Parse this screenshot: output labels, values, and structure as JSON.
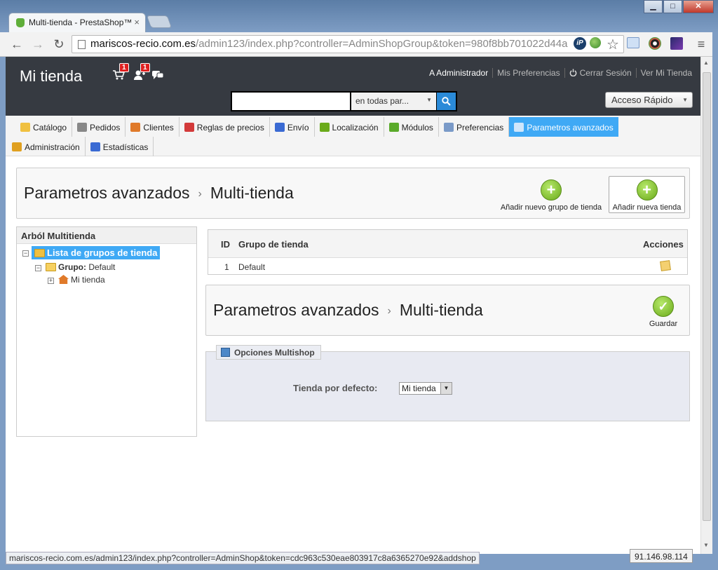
{
  "browser": {
    "tab_title": "Multi-tienda - PrestaShop™",
    "tab_close": "×",
    "url_host": "mariscos-recio.com.es",
    "url_path": "/admin123/index.php?controller=AdminShopGroup&token=980f8bb701022d44a",
    "ip_ext": "iP",
    "status_url": "mariscos-recio.com.es/admin123/index.php?controller=AdminShop&token=cdc963c530eae803917c8a6365270e92&addshop",
    "status_ip": "91.146.98.114",
    "win_minimize": "▁",
    "win_maximize": "□",
    "win_close": "✕",
    "back": "←",
    "forward": "→",
    "reload": "↻",
    "star": "☆",
    "menu_glyph": "≡"
  },
  "header": {
    "shop_name": "Mi tienda",
    "cart_badge": "1",
    "customers_badge": "1",
    "user": "A Administrador",
    "preferences": "Mis Preferencias",
    "logout": "Cerrar Sesión",
    "view_shop": "Ver Mi Tienda",
    "search_scope": "en todas par...",
    "quick_access": "Acceso Rápido"
  },
  "menu": {
    "row1": [
      {
        "label": "Catálogo",
        "icon": "folder-icon",
        "color": "#f0c040"
      },
      {
        "label": "Pedidos",
        "icon": "cart-icon",
        "color": "#888888"
      },
      {
        "label": "Clientes",
        "icon": "user-icon",
        "color": "#e07a2a"
      },
      {
        "label": "Reglas de precios",
        "icon": "price-rule-icon",
        "color": "#d33a3a"
      },
      {
        "label": "Envío",
        "icon": "truck-icon",
        "color": "#3a6ad3"
      },
      {
        "label": "Localización",
        "icon": "globe-icon",
        "color": "#6aaa1a"
      },
      {
        "label": "Módulos",
        "icon": "puzzle-icon",
        "color": "#5aaa2a"
      },
      {
        "label": "Preferencias",
        "icon": "preferences-icon",
        "color": "#7a9ac8"
      },
      {
        "label": "Parametros avanzados",
        "icon": "wrench-icon",
        "color": "#cfe6fb"
      }
    ],
    "row2": [
      {
        "label": "Administración",
        "icon": "key-icon",
        "color": "#e0a020"
      },
      {
        "label": "Estadísticas",
        "icon": "bar-chart-icon",
        "color": "#3a6ad3"
      }
    ]
  },
  "top_toolbar": {
    "crumb1": "Parametros avanzados",
    "crumb2": "Multi-tienda",
    "sep": "›",
    "add_group": "Añadir nuevo grupo de tienda",
    "add_shop": "Añadir nueva tienda",
    "plus": "+"
  },
  "tree": {
    "title": "Arból Multitienda",
    "root": "Lista de grupos de tienda",
    "group_prefix": "Grupo:",
    "group_name": "Default",
    "shop": "Mi tienda",
    "toggle_minus": "−",
    "toggle_plus": "+"
  },
  "table": {
    "col_id": "ID",
    "col_group": "Grupo de tienda",
    "col_actions": "Acciones",
    "rows": [
      {
        "id": "1",
        "name": "Default"
      }
    ]
  },
  "form_toolbar": {
    "crumb1": "Parametros avanzados",
    "crumb2": "Multi-tienda",
    "sep": "›",
    "save": "Guardar",
    "check": "✓"
  },
  "fieldset": {
    "legend": "Opciones Multishop",
    "label": "Tienda por defecto:",
    "select_value": "Mi tienda"
  },
  "colors": {
    "header_bg": "#363a41",
    "accent": "#3fa9f5",
    "green_button": "#6aaa1a"
  }
}
